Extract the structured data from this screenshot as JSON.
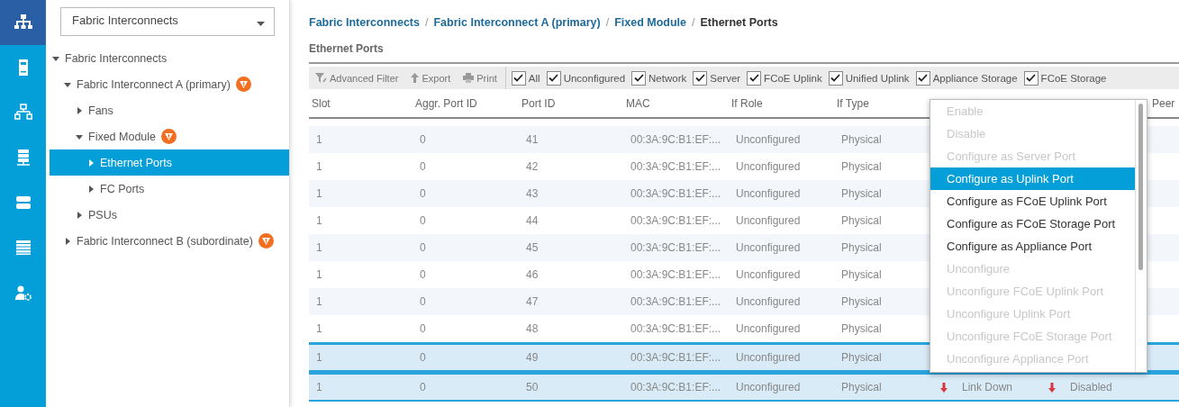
{
  "nav_rail": {
    "items": [
      {
        "selected": true
      },
      {
        "selected": false
      },
      {
        "selected": false
      },
      {
        "selected": false
      },
      {
        "selected": false
      },
      {
        "selected": false
      },
      {
        "selected": false
      }
    ]
  },
  "tree_panel": {
    "filter_dropdown": "Fabric Interconnects",
    "tree": [
      {
        "label": "Fabric Interconnects",
        "expanded": true,
        "selected": false,
        "warning": false,
        "children": [
          {
            "label": "Fabric Interconnect A (primary)",
            "expanded": true,
            "selected": false,
            "warning": true,
            "children": [
              {
                "label": "Fans",
                "expanded": false,
                "selected": false,
                "warning": false
              },
              {
                "label": "Fixed Module",
                "expanded": true,
                "selected": false,
                "warning": true,
                "children": [
                  {
                    "label": "Ethernet Ports",
                    "expanded": false,
                    "selected": true,
                    "warning": false
                  },
                  {
                    "label": "FC Ports",
                    "expanded": false,
                    "selected": false,
                    "warning": false
                  }
                ]
              },
              {
                "label": "PSUs",
                "expanded": false,
                "selected": false,
                "warning": false
              }
            ]
          },
          {
            "label": "Fabric Interconnect B (subordinate)",
            "expanded": false,
            "selected": false,
            "warning": true
          }
        ]
      }
    ]
  },
  "breadcrumb": [
    {
      "label": "Fabric Interconnects",
      "current": false
    },
    {
      "separator": "/",
      "label": "Fabric Interconnect A (primary)",
      "current": false
    },
    {
      "separator": "/",
      "label": "Fixed Module",
      "current": false
    },
    {
      "separator": "/",
      "label": "Ethernet Ports",
      "current": true
    }
  ],
  "section_title": "Ethernet Ports",
  "toolbar": {
    "actions": [
      {
        "kind": "filter",
        "label": "Advanced Filter"
      },
      {
        "kind": "export",
        "label": "Export"
      },
      {
        "kind": "print",
        "label": "Print"
      }
    ],
    "filters": [
      {
        "label": "All",
        "checked": true
      },
      {
        "label": "Unconfigured",
        "checked": true
      },
      {
        "label": "Network",
        "checked": true
      },
      {
        "label": "Server",
        "checked": true
      },
      {
        "label": "FCoE Uplink",
        "checked": true
      },
      {
        "label": "Unified Uplink",
        "checked": true
      },
      {
        "label": "Appliance Storage",
        "checked": true
      },
      {
        "label": "FCoE Storage",
        "checked": true
      }
    ]
  },
  "table": {
    "columns": [
      "Slot",
      "Aggr. Port ID",
      "Port ID",
      "MAC",
      "If Role",
      "If Type",
      "",
      "",
      "Peer"
    ],
    "rows": [
      {
        "slot": "1",
        "aggr_port_id": "0",
        "port_id": "41",
        "mac": "00:3A:9C:B1:EF:...",
        "if_role": "Unconfigured",
        "if_type": "Physical",
        "selected": false
      },
      {
        "slot": "1",
        "aggr_port_id": "0",
        "port_id": "42",
        "mac": "00:3A:9C:B1:EF:...",
        "if_role": "Unconfigured",
        "if_type": "Physical",
        "selected": false
      },
      {
        "slot": "1",
        "aggr_port_id": "0",
        "port_id": "43",
        "mac": "00:3A:9C:B1:EF:...",
        "if_role": "Unconfigured",
        "if_type": "Physical",
        "selected": false
      },
      {
        "slot": "1",
        "aggr_port_id": "0",
        "port_id": "44",
        "mac": "00:3A:9C:B1:EF:...",
        "if_role": "Unconfigured",
        "if_type": "Physical",
        "selected": false
      },
      {
        "slot": "1",
        "aggr_port_id": "0",
        "port_id": "45",
        "mac": "00:3A:9C:B1:EF:...",
        "if_role": "Unconfigured",
        "if_type": "Physical",
        "selected": false
      },
      {
        "slot": "1",
        "aggr_port_id": "0",
        "port_id": "46",
        "mac": "00:3A:9C:B1:EF:...",
        "if_role": "Unconfigured",
        "if_type": "Physical",
        "selected": false
      },
      {
        "slot": "1",
        "aggr_port_id": "0",
        "port_id": "47",
        "mac": "00:3A:9C:B1:EF:...",
        "if_role": "Unconfigured",
        "if_type": "Physical",
        "selected": false
      },
      {
        "slot": "1",
        "aggr_port_id": "0",
        "port_id": "48",
        "mac": "00:3A:9C:B1:EF:...",
        "if_role": "Unconfigured",
        "if_type": "Physical",
        "selected": false
      },
      {
        "slot": "1",
        "aggr_port_id": "0",
        "port_id": "49",
        "mac": "00:3A:9C:B1:EF:...",
        "if_role": "Unconfigured",
        "if_type": "Physical",
        "selected": true
      },
      {
        "slot": "1",
        "aggr_port_id": "0",
        "port_id": "50",
        "mac": "00:3A:9C:B1:EF:...",
        "if_role": "Unconfigured",
        "if_type": "Physical",
        "column_7": "Link Down",
        "column_8": "Disabled",
        "selected": true
      }
    ]
  },
  "context_menu": {
    "items": [
      {
        "label": "Enable",
        "disabled": true,
        "selected": false
      },
      {
        "label": "Disable",
        "disabled": true,
        "selected": false
      },
      {
        "label": "Configure as Server Port",
        "disabled": true,
        "selected": false
      },
      {
        "label": "Configure as Uplink Port",
        "disabled": false,
        "selected": true
      },
      {
        "label": "Configure as FCoE Uplink Port",
        "disabled": false,
        "selected": false
      },
      {
        "label": "Configure as FCoE Storage Port",
        "disabled": false,
        "selected": false
      },
      {
        "label": "Configure as Appliance Port",
        "disabled": false,
        "selected": false
      },
      {
        "label": "Unconfigure",
        "disabled": true,
        "selected": false
      },
      {
        "label": "Unconfigure FCoE Uplink Port",
        "disabled": true,
        "selected": false
      },
      {
        "label": "Unconfigure Uplink Port",
        "disabled": true,
        "selected": false
      },
      {
        "label": "Unconfigure FCoE Storage Port",
        "disabled": true,
        "selected": false
      },
      {
        "label": "Unconfigure Appliance Port",
        "disabled": true,
        "selected": false
      }
    ]
  }
}
